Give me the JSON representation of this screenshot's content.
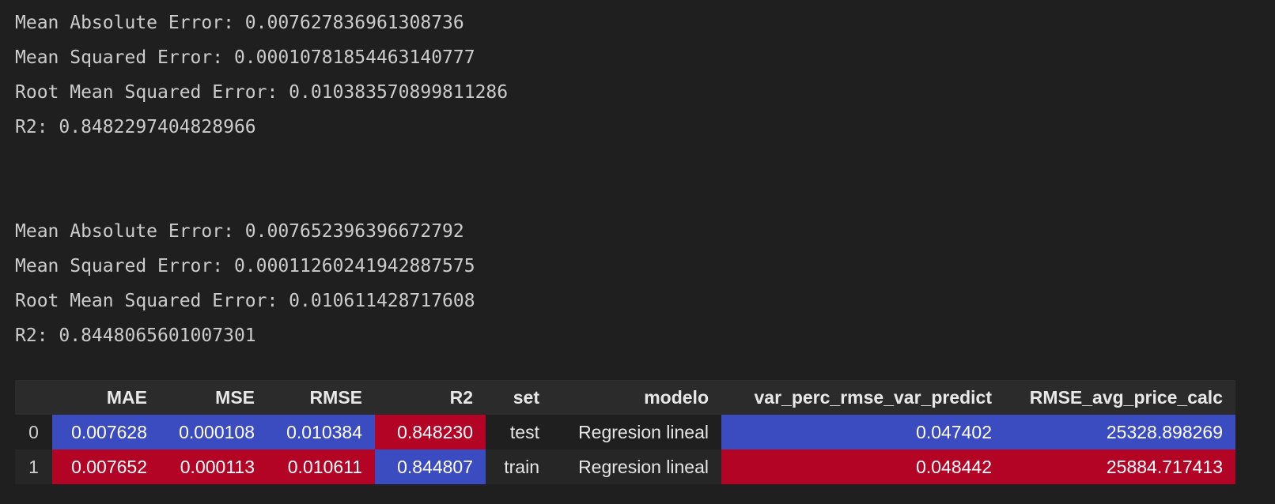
{
  "output_block_1": {
    "lines": [
      "Mean Absolute Error: 0.007627836961308736",
      "Mean Squared Error: 0.00010781854463140777",
      "Root Mean Squared Error: 0.010383570899811286",
      "R2: 0.8482297404828966"
    ]
  },
  "output_block_2": {
    "lines": [
      "Mean Absolute Error: 0.007652396396672792",
      "Mean Squared Error: 0.00011260241942887575",
      "Root Mean Squared Error: 0.010611428717608",
      "R2: 0.8448065601007301"
    ]
  },
  "table": {
    "index_header": "",
    "headers": [
      "MAE",
      "MSE",
      "RMSE",
      "R2",
      "set",
      "modelo",
      "var_perc_rmse_var_predict",
      "RMSE_avg_price_calc"
    ],
    "rows": [
      {
        "index": "0",
        "cells": [
          "0.007628",
          "0.000108",
          "0.010384",
          "0.848230",
          "test",
          "Regresion lineal",
          "0.047402",
          "25328.898269"
        ]
      },
      {
        "index": "1",
        "cells": [
          "0.007652",
          "0.000113",
          "0.010611",
          "0.844807",
          "train",
          "Regresion lineal",
          "0.048442",
          "25884.717413"
        ]
      }
    ]
  },
  "colors": {
    "low_blue": "#3b4cc0",
    "high_red": "#b40426"
  }
}
